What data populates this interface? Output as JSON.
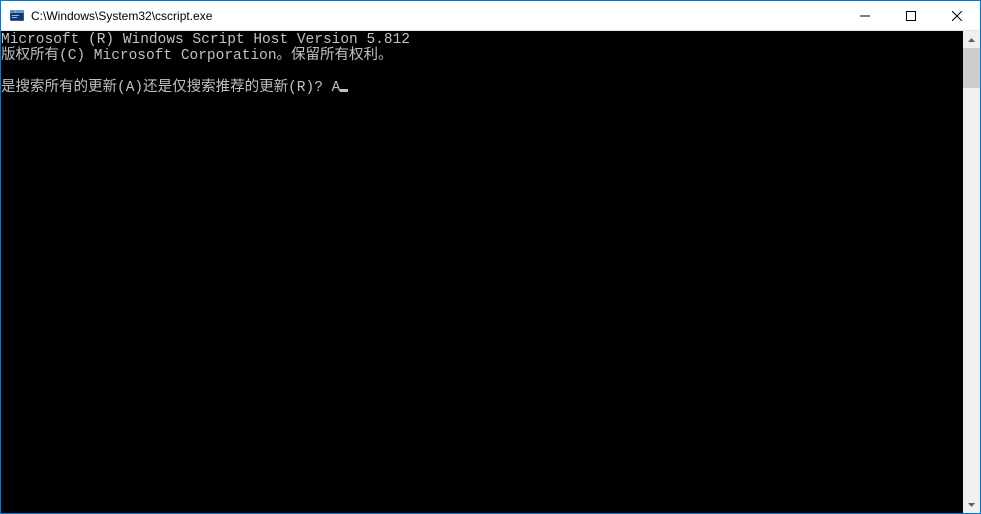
{
  "window": {
    "title": "C:\\Windows\\System32\\cscript.exe"
  },
  "console": {
    "line1": "Microsoft (R) Windows Script Host Version 5.812",
    "line2": "版权所有(C) Microsoft Corporation。保留所有权利。",
    "line3": "",
    "prompt": "是搜索所有的更新(A)还是仅搜索推荐的更新(R)? ",
    "input": "A"
  },
  "colors": {
    "window_border": "#0078d7",
    "console_bg": "#000000",
    "console_fg": "#c0c0c0",
    "titlebar_bg": "#ffffff"
  }
}
